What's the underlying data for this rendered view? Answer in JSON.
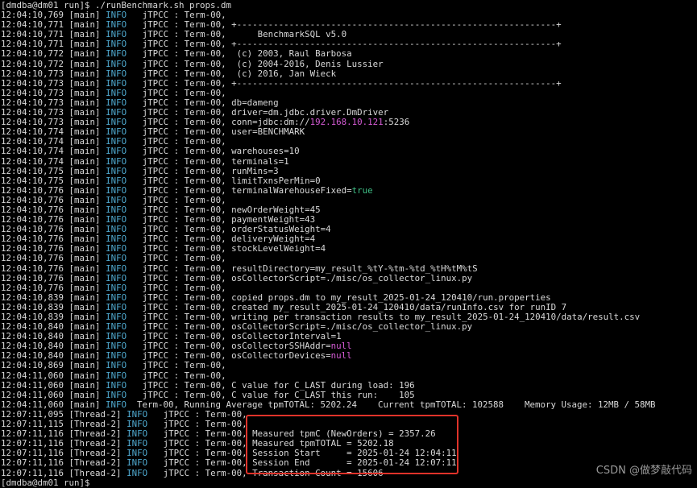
{
  "prompt": "[dmdba@dm01 run]$ ./runBenchmark.sh props.dm",
  "lines": [
    {
      "ts": "12:04:10,769",
      "thread": "[main]",
      "level": "INFO",
      "src": "jTPCC",
      "term": "Term-00,",
      "msg": []
    },
    {
      "ts": "12:04:10,771",
      "thread": "[main]",
      "level": "INFO",
      "src": "jTPCC",
      "term": "Term-00,",
      "msg": [
        {
          "t": "+-------------------------------------------------------------+"
        }
      ]
    },
    {
      "ts": "12:04:10,771",
      "thread": "[main]",
      "level": "INFO",
      "src": "jTPCC",
      "term": "Term-00,",
      "msg": [
        {
          "t": "     BenchmarkSQL v5.0"
        }
      ]
    },
    {
      "ts": "12:04:10,771",
      "thread": "[main]",
      "level": "INFO",
      "src": "jTPCC",
      "term": "Term-00,",
      "msg": [
        {
          "t": "+-------------------------------------------------------------+"
        }
      ]
    },
    {
      "ts": "12:04:10,772",
      "thread": "[main]",
      "level": "INFO",
      "src": "jTPCC",
      "term": "Term-00,",
      "msg": [
        {
          "t": " (c) 2003, Raul Barbosa"
        }
      ]
    },
    {
      "ts": "12:04:10,772",
      "thread": "[main]",
      "level": "INFO",
      "src": "jTPCC",
      "term": "Term-00,",
      "msg": [
        {
          "t": " (c) 2004-2016, Denis Lussier"
        }
      ]
    },
    {
      "ts": "12:04:10,773",
      "thread": "[main]",
      "level": "INFO",
      "src": "jTPCC",
      "term": "Term-00,",
      "msg": [
        {
          "t": " (c) 2016, Jan Wieck"
        }
      ]
    },
    {
      "ts": "12:04:10,773",
      "thread": "[main]",
      "level": "INFO",
      "src": "jTPCC",
      "term": "Term-00,",
      "msg": [
        {
          "t": "+-------------------------------------------------------------+"
        }
      ]
    },
    {
      "ts": "12:04:10,773",
      "thread": "[main]",
      "level": "INFO",
      "src": "jTPCC",
      "term": "Term-00,",
      "msg": []
    },
    {
      "ts": "12:04:10,773",
      "thread": "[main]",
      "level": "INFO",
      "src": "jTPCC",
      "term": "Term-00,",
      "msg": [
        {
          "t": "db=dameng"
        }
      ]
    },
    {
      "ts": "12:04:10,773",
      "thread": "[main]",
      "level": "INFO",
      "src": "jTPCC",
      "term": "Term-00,",
      "msg": [
        {
          "t": "driver=dm.jdbc.driver.DmDriver"
        }
      ]
    },
    {
      "ts": "12:04:10,773",
      "thread": "[main]",
      "level": "INFO",
      "src": "jTPCC",
      "term": "Term-00,",
      "msg": [
        {
          "t": "conn=jdbc:dm://"
        },
        {
          "t": "192.168.10.121",
          "c": "purple"
        },
        {
          "t": ":5236"
        }
      ]
    },
    {
      "ts": "12:04:10,774",
      "thread": "[main]",
      "level": "INFO",
      "src": "jTPCC",
      "term": "Term-00,",
      "msg": [
        {
          "t": "user=BENCHMARK"
        }
      ]
    },
    {
      "ts": "12:04:10,774",
      "thread": "[main]",
      "level": "INFO",
      "src": "jTPCC",
      "term": "Term-00,",
      "msg": []
    },
    {
      "ts": "12:04:10,774",
      "thread": "[main]",
      "level": "INFO",
      "src": "jTPCC",
      "term": "Term-00,",
      "msg": [
        {
          "t": "warehouses=10"
        }
      ]
    },
    {
      "ts": "12:04:10,774",
      "thread": "[main]",
      "level": "INFO",
      "src": "jTPCC",
      "term": "Term-00,",
      "msg": [
        {
          "t": "terminals=1"
        }
      ]
    },
    {
      "ts": "12:04:10,775",
      "thread": "[main]",
      "level": "INFO",
      "src": "jTPCC",
      "term": "Term-00,",
      "msg": [
        {
          "t": "runMins=3"
        }
      ]
    },
    {
      "ts": "12:04:10,775",
      "thread": "[main]",
      "level": "INFO",
      "src": "jTPCC",
      "term": "Term-00,",
      "msg": [
        {
          "t": "limitTxnsPerMin=0"
        }
      ]
    },
    {
      "ts": "12:04:10,776",
      "thread": "[main]",
      "level": "INFO",
      "src": "jTPCC",
      "term": "Term-00,",
      "msg": [
        {
          "t": "terminalWarehouseFixed="
        },
        {
          "t": "true",
          "c": "green"
        }
      ]
    },
    {
      "ts": "12:04:10,776",
      "thread": "[main]",
      "level": "INFO",
      "src": "jTPCC",
      "term": "Term-00,",
      "msg": []
    },
    {
      "ts": "12:04:10,776",
      "thread": "[main]",
      "level": "INFO",
      "src": "jTPCC",
      "term": "Term-00,",
      "msg": [
        {
          "t": "newOrderWeight=45"
        }
      ]
    },
    {
      "ts": "12:04:10,776",
      "thread": "[main]",
      "level": "INFO",
      "src": "jTPCC",
      "term": "Term-00,",
      "msg": [
        {
          "t": "paymentWeight=43"
        }
      ]
    },
    {
      "ts": "12:04:10,776",
      "thread": "[main]",
      "level": "INFO",
      "src": "jTPCC",
      "term": "Term-00,",
      "msg": [
        {
          "t": "orderStatusWeight=4"
        }
      ]
    },
    {
      "ts": "12:04:10,776",
      "thread": "[main]",
      "level": "INFO",
      "src": "jTPCC",
      "term": "Term-00,",
      "msg": [
        {
          "t": "deliveryWeight=4"
        }
      ]
    },
    {
      "ts": "12:04:10,776",
      "thread": "[main]",
      "level": "INFO",
      "src": "jTPCC",
      "term": "Term-00,",
      "msg": [
        {
          "t": "stockLevelWeight=4"
        }
      ]
    },
    {
      "ts": "12:04:10,776",
      "thread": "[main]",
      "level": "INFO",
      "src": "jTPCC",
      "term": "Term-00,",
      "msg": []
    },
    {
      "ts": "12:04:10,776",
      "thread": "[main]",
      "level": "INFO",
      "src": "jTPCC",
      "term": "Term-00,",
      "msg": [
        {
          "t": "resultDirectory=my_result_%tY-%tm-%td_%tH%tM%tS"
        }
      ]
    },
    {
      "ts": "12:04:10,776",
      "thread": "[main]",
      "level": "INFO",
      "src": "jTPCC",
      "term": "Term-00,",
      "msg": [
        {
          "t": "osCollectorScript=./misc/os_collector_linux.py"
        }
      ]
    },
    {
      "ts": "12:04:10,776",
      "thread": "[main]",
      "level": "INFO",
      "src": "jTPCC",
      "term": "Term-00,",
      "msg": []
    },
    {
      "ts": "12:04:10,839",
      "thread": "[main]",
      "level": "INFO",
      "src": "jTPCC",
      "term": "Term-00,",
      "msg": [
        {
          "t": "copied props.dm to my_result_2025-01-24_120410/run.properties"
        }
      ]
    },
    {
      "ts": "12:04:10,839",
      "thread": "[main]",
      "level": "INFO",
      "src": "jTPCC",
      "term": "Term-00,",
      "msg": [
        {
          "t": "created my_result_2025-01-24_120410/data/runInfo.csv for runID 7"
        }
      ]
    },
    {
      "ts": "12:04:10,839",
      "thread": "[main]",
      "level": "INFO",
      "src": "jTPCC",
      "term": "Term-00,",
      "msg": [
        {
          "t": "writing per transaction results to my_result_2025-01-24_120410/data/result.csv"
        }
      ]
    },
    {
      "ts": "12:04:10,840",
      "thread": "[main]",
      "level": "INFO",
      "src": "jTPCC",
      "term": "Term-00,",
      "msg": [
        {
          "t": "osCollectorScript=./misc/os_collector_linux.py"
        }
      ]
    },
    {
      "ts": "12:04:10,840",
      "thread": "[main]",
      "level": "INFO",
      "src": "jTPCC",
      "term": "Term-00,",
      "msg": [
        {
          "t": "osCollectorInterval=1"
        }
      ]
    },
    {
      "ts": "12:04:10,840",
      "thread": "[main]",
      "level": "INFO",
      "src": "jTPCC",
      "term": "Term-00,",
      "msg": [
        {
          "t": "osCollectorSSHAddr="
        },
        {
          "t": "null",
          "c": "purple"
        }
      ]
    },
    {
      "ts": "12:04:10,840",
      "thread": "[main]",
      "level": "INFO",
      "src": "jTPCC",
      "term": "Term-00,",
      "msg": [
        {
          "t": "osCollectorDevices="
        },
        {
          "t": "null",
          "c": "purple"
        }
      ]
    },
    {
      "ts": "12:04:10,869",
      "thread": "[main]",
      "level": "INFO",
      "src": "jTPCC",
      "term": "Term-00,",
      "msg": []
    },
    {
      "ts": "12:04:11,060",
      "thread": "[main]",
      "level": "INFO",
      "src": "jTPCC",
      "term": "Term-00,",
      "msg": []
    },
    {
      "ts": "12:04:11,060",
      "thread": "[main]",
      "level": "INFO",
      "src": "jTPCC",
      "term": "Term-00,",
      "msg": [
        {
          "t": "C value for C_LAST during load: 196"
        }
      ]
    },
    {
      "ts": "12:04:11,060",
      "thread": "[main]",
      "level": "INFO",
      "src": "jTPCC",
      "term": "Term-00,",
      "msg": [
        {
          "t": "C value for C_LAST this run:    105"
        }
      ]
    },
    {
      "raw": [
        {
          "t": "12:04:11,060 [main] "
        },
        {
          "t": "INFO",
          "c": "cyan"
        },
        {
          "t": "  Term-00, Running Average tpmTOTAL: 5202.24    Current tpmTOTAL: 102588    Memory Usage: 12MB / 58MB"
        }
      ]
    },
    {
      "ts": "12:07:11,095",
      "thread": "[Thread-2]",
      "level": "INFO",
      "src": "jTPCC",
      "term": "Term-00,",
      "msg": []
    },
    {
      "ts": "12:07:11,115",
      "thread": "[Thread-2]",
      "level": "INFO",
      "src": "jTPCC",
      "term": "Term-00,",
      "msg": []
    },
    {
      "ts": "12:07:11,116",
      "thread": "[Thread-2]",
      "level": "INFO",
      "src": "jTPCC",
      "term": "Term-00,",
      "msg": [
        {
          "t": "Measured tpmC (NewOrders) = 2357.26"
        }
      ]
    },
    {
      "ts": "12:07:11,116",
      "thread": "[Thread-2]",
      "level": "INFO",
      "src": "jTPCC",
      "term": "Term-00,",
      "msg": [
        {
          "t": "Measured tpmTOTAL = 5202.18"
        }
      ]
    },
    {
      "ts": "12:07:11,116",
      "thread": "[Thread-2]",
      "level": "INFO",
      "src": "jTPCC",
      "term": "Term-00,",
      "msg": [
        {
          "t": "Session Start     = 2025-01-24 12:04:11"
        }
      ]
    },
    {
      "ts": "12:07:11,116",
      "thread": "[Thread-2]",
      "level": "INFO",
      "src": "jTPCC",
      "term": "Term-00,",
      "msg": [
        {
          "t": "Session End       = 2025-01-24 12:07:11"
        }
      ]
    },
    {
      "ts": "12:07:11,116",
      "thread": "[Thread-2]",
      "level": "INFO",
      "src": "jTPCC",
      "term": "Term-00,",
      "msg": [
        {
          "t": "Transaction Count = 15606"
        }
      ]
    }
  ],
  "end_prompt": "[dmdba@dm01 run]$",
  "watermark": "CSDN @做梦敲代码",
  "colors": {
    "background": "#000000",
    "text": "#d9d9d9",
    "level": "#4fa9cf",
    "ip_and_null": "#d65bd6",
    "true": "#3fbf86",
    "highlight": "#e0332a"
  }
}
